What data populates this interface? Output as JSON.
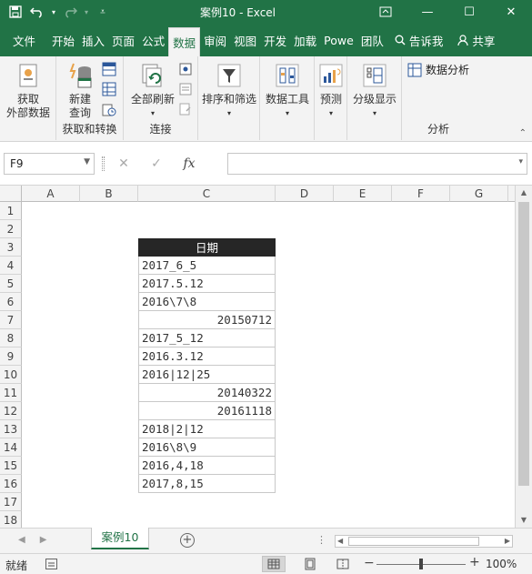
{
  "window": {
    "title": "案例10  -  Excel",
    "qat": [
      "save-icon",
      "undo-icon",
      "redo-icon",
      "customize-icon"
    ],
    "controls": [
      "ribbon-options-icon",
      "minimize-icon",
      "maximize-icon",
      "close-icon"
    ]
  },
  "tabs": [
    "文件",
    "开始",
    "插入",
    "页面",
    "公式",
    "数据",
    "审阅",
    "视图",
    "开发",
    "加载",
    "Powe",
    "团队"
  ],
  "active_tab": "数据",
  "tell_me": "告诉我",
  "share": "共享",
  "ribbon": {
    "get_external": "获取\n外部数据",
    "new_query": "新建\n查询",
    "group1": "获取和转换",
    "refresh_all": "全部刷新",
    "group2": "连接",
    "sort_filter": "排序和筛选",
    "data_tools": "数据工具",
    "forecast": "预测",
    "outline": "分级显示",
    "data_analysis": "数据分析",
    "group3": "分析"
  },
  "formula_bar": {
    "name_box": "F9",
    "cancel": "✕",
    "enter": "✓",
    "fx": "fx",
    "formula": ""
  },
  "columns": [
    "A",
    "B",
    "C",
    "D",
    "E",
    "F",
    "G"
  ],
  "rows": [
    "1",
    "2",
    "3",
    "4",
    "5",
    "6",
    "7",
    "8",
    "9",
    "10",
    "11",
    "12",
    "13",
    "14",
    "15",
    "16",
    "17",
    "18"
  ],
  "table": {
    "header": "日期",
    "values": [
      {
        "text": "2017_6_5",
        "align": "left"
      },
      {
        "text": "2017.5.12",
        "align": "left"
      },
      {
        "text": "2016\\7\\8",
        "align": "left"
      },
      {
        "text": "20150712",
        "align": "right"
      },
      {
        "text": "2017_5_12",
        "align": "left"
      },
      {
        "text": "2016.3.12",
        "align": "left"
      },
      {
        "text": "2016|12|25",
        "align": "left"
      },
      {
        "text": "20140322",
        "align": "right"
      },
      {
        "text": "20161118",
        "align": "right"
      },
      {
        "text": "2018|2|12",
        "align": "left"
      },
      {
        "text": "2016\\8\\9",
        "align": "left"
      },
      {
        "text": "2016,4,18",
        "align": "left"
      },
      {
        "text": "2017,8,15",
        "align": "left"
      }
    ]
  },
  "sheet_tab": "案例10",
  "status": {
    "ready": "就绪",
    "zoom": "100%",
    "zoom_level": 1.0
  },
  "colors": {
    "accent": "#217346",
    "header_fill": "#262626"
  }
}
